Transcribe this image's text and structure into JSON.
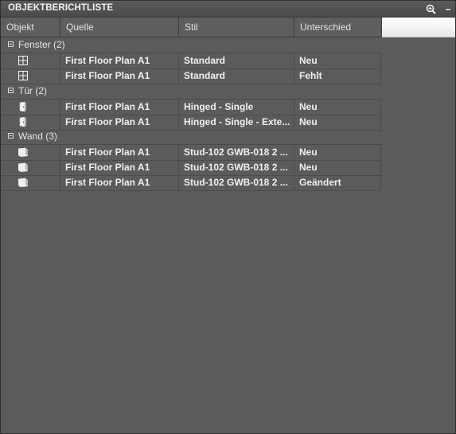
{
  "panel": {
    "title": "OBJEKTBERICHTLISTE",
    "buttons": [
      {
        "name": "zoom-icon"
      },
      {
        "name": "minimize-icon"
      }
    ]
  },
  "columns": [
    "Objekt",
    "Quelle",
    "Stil",
    "Unterschied"
  ],
  "groups": [
    {
      "label": "Fenster (2)",
      "icon": "window-icon",
      "rows": [
        {
          "source": "First Floor Plan A1",
          "style": "Standard",
          "diff": "Neu"
        },
        {
          "source": "First Floor Plan A1",
          "style": "Standard",
          "diff": "Fehlt"
        }
      ]
    },
    {
      "label": "Tür (2)",
      "icon": "door-icon",
      "rows": [
        {
          "source": "First Floor Plan A1",
          "style": "Hinged - Single",
          "diff": "Neu"
        },
        {
          "source": "First Floor Plan A1",
          "style": "Hinged - Single - Exte...",
          "diff": "Neu"
        }
      ]
    },
    {
      "label": "Wand (3)",
      "icon": "wall-icon",
      "rows": [
        {
          "source": "First Floor Plan A1",
          "style": "Stud-102 GWB-018 2 ...",
          "diff": "Neu"
        },
        {
          "source": "First Floor Plan A1",
          "style": "Stud-102 GWB-018 2 ...",
          "diff": "Neu"
        },
        {
          "source": "First Floor Plan A1",
          "style": "Stud-102 GWB-018 2 ...",
          "diff": "Geändert"
        }
      ]
    }
  ]
}
